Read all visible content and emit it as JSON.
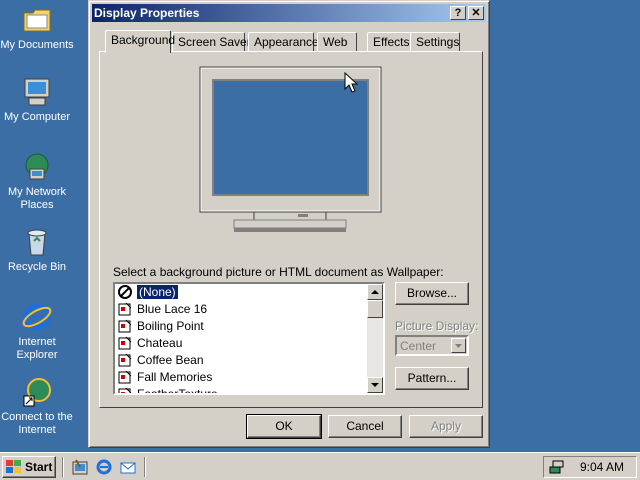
{
  "desktop": {
    "icons": [
      {
        "label": "My Documents",
        "icon": "folder-icon"
      },
      {
        "label": "My Computer",
        "icon": "computer-icon"
      },
      {
        "label": "My Network Places",
        "icon": "network-icon"
      },
      {
        "label": "Recycle Bin",
        "icon": "recycle-bin-icon"
      },
      {
        "label": "Internet Explorer",
        "icon": "internet-explorer-icon"
      },
      {
        "label": "Connect to the Internet",
        "icon": "connect-internet-icon"
      }
    ]
  },
  "dialog": {
    "title": "Display Properties",
    "help_button": "?",
    "close_button": "✕",
    "tabs": [
      {
        "label": "Background",
        "active": true
      },
      {
        "label": "Screen Saver"
      },
      {
        "label": "Appearance"
      },
      {
        "label": "Web"
      },
      {
        "label": "Effects"
      },
      {
        "label": "Settings"
      }
    ],
    "preview_color": "#3a6ea5",
    "wallpaper_prompt": "Select a background picture or HTML document as Wallpaper:",
    "wallpapers": [
      {
        "label": "(None)",
        "selected": true,
        "icon": "none-icon"
      },
      {
        "label": "Blue Lace 16",
        "icon": "bitmap-icon"
      },
      {
        "label": "Boiling Point",
        "icon": "bitmap-icon"
      },
      {
        "label": "Chateau",
        "icon": "bitmap-icon"
      },
      {
        "label": "Coffee Bean",
        "icon": "bitmap-icon"
      },
      {
        "label": "Fall Memories",
        "icon": "bitmap-icon"
      },
      {
        "label": "FeatherTexture",
        "icon": "bitmap-icon"
      }
    ],
    "browse_button": "Browse...",
    "picture_display_label": "Picture Display:",
    "picture_display_value": "Center",
    "pattern_button": "Pattern...",
    "ok_button": "OK",
    "cancel_button": "Cancel",
    "apply_button": "Apply"
  },
  "taskbar": {
    "start_label": "Start",
    "clock": "9:04 AM",
    "quick_launch": [
      "show-desktop-icon",
      "internet-explorer-icon",
      "outlook-express-icon"
    ]
  },
  "colors": {
    "desktop": "#3a6ea5",
    "title_active": "#0a246a",
    "face": "#d4d0c8"
  }
}
